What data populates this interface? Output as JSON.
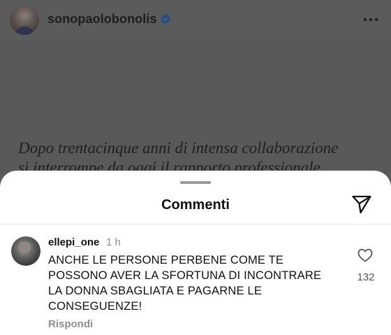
{
  "post": {
    "username": "sonopaolobonolis",
    "verified": true,
    "verified_icon": "verified-badge-icon",
    "more_icon": "more-options-icon",
    "caption": "Dopo trentacinque anni di intensa collaborazione\nsi interrompe da oggi il rapporto professionale"
  },
  "comments_sheet": {
    "title": "Commenti",
    "share_icon": "send-paper-plane-icon",
    "comments": [
      {
        "username": "ellepi_one",
        "time": "1 h",
        "text": "ANCHE LE PERSONE PERBENE COME TE\nPOSSONO AVER LA SFORTUNA DI INCONTRARE\nLA DONNA SBAGLIATA E PAGARNE LE\nCONSEGUENZE!",
        "reply_label": "Rispondi",
        "like_icon": "heart-outline-icon",
        "like_count": "132"
      }
    ]
  },
  "colors": {
    "overlay_dim": "#5b5b5b",
    "verified_blue": "#3897f0",
    "sheet_bg": "#ffffff",
    "text_primary": "#111111",
    "text_secondary": "#8e8e8e"
  }
}
